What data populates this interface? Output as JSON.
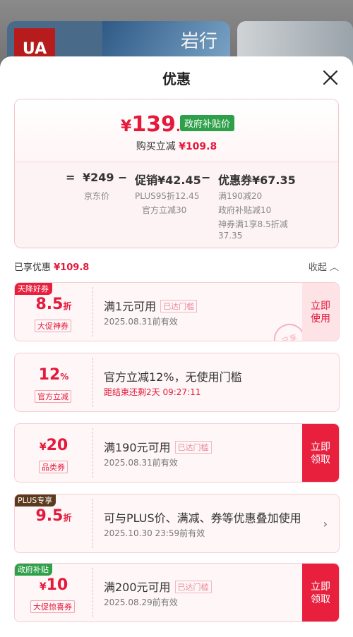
{
  "background": {
    "banner_text": "岩行"
  },
  "sheet": {
    "title": "优惠"
  },
  "summary": {
    "price_symbol": "¥",
    "price_int": "139",
    "price_dec": ".2",
    "price_tag": "政府补贴价",
    "instant_label": "购买立减",
    "instant_value": "¥109.8",
    "eq": "=",
    "base_price": "¥249",
    "base_label": "京东价",
    "minus1": "−",
    "promo": "促销¥42.45",
    "promo_sub1": "PLUS95折12.45",
    "promo_sub2": "官方立减30",
    "minus2": "−",
    "coupon": "优惠券¥67.35",
    "coupon_sub1": "满190减20",
    "coupon_sub2": "政府补贴减10",
    "coupon_sub3": "神券满1享8.5折减",
    "coupon_sub4": "37.35"
  },
  "enjoy": {
    "label": "已享优惠",
    "value": "¥109.8",
    "collapse": "收起 ︿"
  },
  "coupons": [
    {
      "corner": "天降好券",
      "corner_color": "#e8203e",
      "value": "8.5",
      "unit": "折",
      "label": "大促神券",
      "main": "满1元可用",
      "mini": "已达门槛",
      "expire": "2025.08.31前有效",
      "action": "立即使用",
      "stamp": "已享"
    },
    {
      "value": "12",
      "unit": "%",
      "label": "官方立减",
      "main": "官方立减12%，无使用门槛",
      "expire": "距结束还剩2天 09:27:11"
    },
    {
      "sym": "¥",
      "value": "20",
      "label": "品类券",
      "main": "满190元可用",
      "mini": "已达门槛",
      "expire": "2025.08.31前有效",
      "action": "立即领取"
    },
    {
      "corner": "PLUS专享",
      "corner_color": "#5b3a1e",
      "value": "9.5",
      "unit": "折",
      "main": "可与PLUS价、满减、券等优惠叠加使用",
      "expire": "2025.10.30 23:59前有效",
      "arrow": "›"
    },
    {
      "corner": "政府补贴",
      "corner_color": "#2fa04a",
      "sym": "¥",
      "value": "10",
      "label": "大促惊喜券",
      "main": "满200元可用",
      "mini": "已达门槛",
      "expire": "2025.08.29前有效",
      "action": "立即领取"
    }
  ]
}
